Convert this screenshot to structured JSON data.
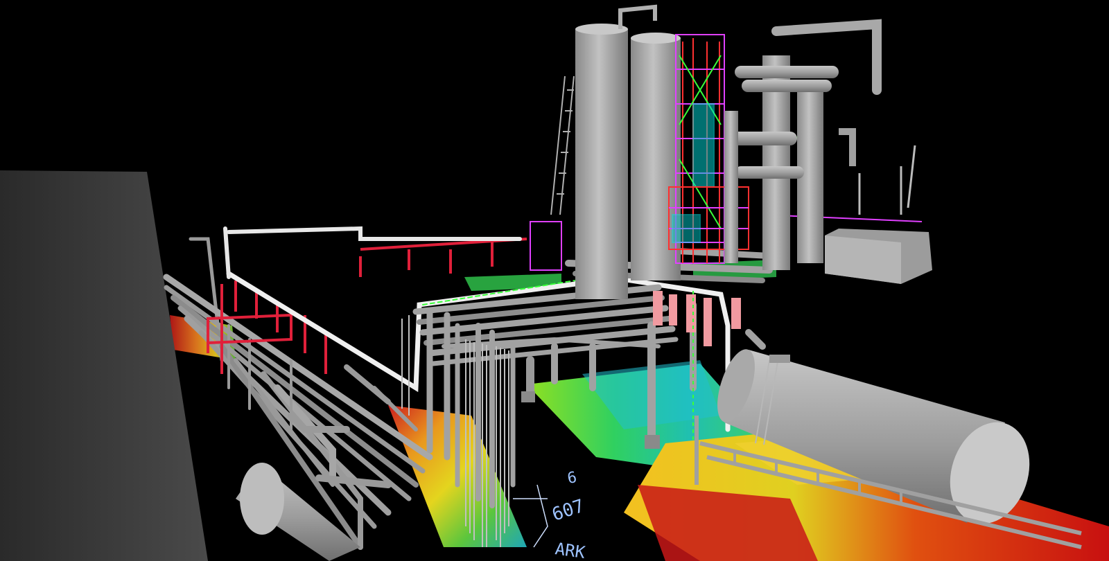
{
  "scene": {
    "labels": [
      "607",
      "6",
      "ARK"
    ],
    "colors": {
      "background": "#000000",
      "steel": "#9a9a9a",
      "steel_dark": "#6e6e6e",
      "steel_light": "#bdbdbd",
      "red_structure": "#e0203a",
      "pink_supports": "#f19aa0",
      "magenta": "#e040ff",
      "cyan": "#00e6e6",
      "green_line": "#39ff39",
      "label_blue": "#9ec3ff"
    }
  }
}
